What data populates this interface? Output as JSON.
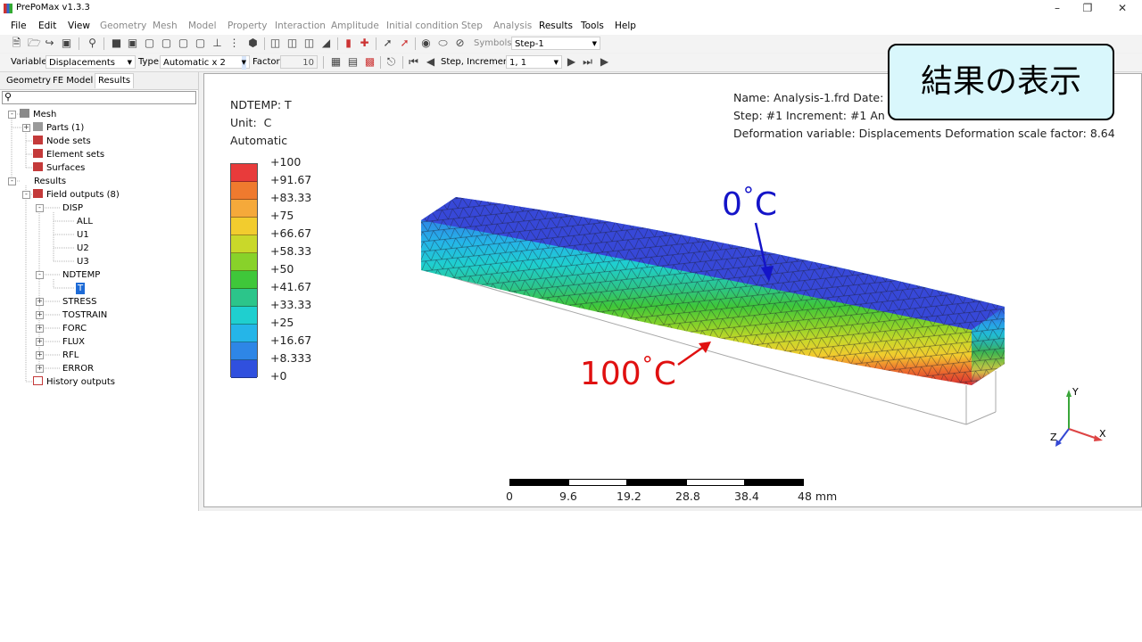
{
  "window": {
    "title": "PrePoMax v1.3.3"
  },
  "menu": [
    "File",
    "Edit",
    "View",
    "Geometry",
    "Mesh",
    "Model",
    "Property",
    "Interaction",
    "Amplitude",
    "Initial condition",
    "Step",
    "Analysis",
    "Results",
    "Tools",
    "Help"
  ],
  "toolbar": {
    "symbols_label": "Symbols",
    "symbols_value": "Step-1",
    "variable_label": "Variable",
    "variable_value": "Displacements",
    "type_label": "Type",
    "type_value": "Automatic x 2",
    "factor_label": "Factor",
    "factor_value": "10",
    "step_increment_label": "Step, Increment",
    "step_increment_value": "1, 1"
  },
  "left_panel": {
    "tabs": [
      "Geometry",
      "FE Model",
      "Results"
    ],
    "active_tab": "Results",
    "search_value": "",
    "tree": {
      "mesh": "Mesh",
      "parts": "Parts (1)",
      "node_sets": "Node sets",
      "element_sets": "Element sets",
      "surfaces": "Surfaces",
      "results": "Results",
      "field_outputs": "Field outputs (8)",
      "disp": "DISP",
      "disp_children": [
        "ALL",
        "U1",
        "U2",
        "U3"
      ],
      "ndtemp": "NDTEMP",
      "ndtemp_child": "T",
      "others": [
        "STRESS",
        "TOSTRAIN",
        "FORC",
        "FLUX",
        "RFL",
        "ERROR"
      ],
      "history_outputs": "History outputs"
    }
  },
  "viewport": {
    "legend": {
      "variable": "NDTEMP: T",
      "unit": "Unit:  C",
      "mode": "Automatic",
      "values": [
        "+100",
        "+91.67",
        "+83.33",
        "+75",
        "+66.67",
        "+58.33",
        "+50",
        "+41.67",
        "+33.33",
        "+25",
        "+16.67",
        "+8.333",
        "+0"
      ],
      "colors": [
        "#e83b3b",
        "#ef7a2e",
        "#f5a93a",
        "#f2cc2e",
        "#c9d82a",
        "#88d22a",
        "#3fc73a",
        "#2cc58a",
        "#1fcfcf",
        "#25b5e8",
        "#2e86e6",
        "#3050de"
      ]
    },
    "info": {
      "line1": "Name: Analysis-1.frd   Date:",
      "line2": "Step: #1   Increment: #1   An",
      "line3": "Deformation variable: Displacements   Deformation scale factor: 8.64"
    },
    "scale_labels": [
      "0",
      "9.6",
      "19.2",
      "28.8",
      "38.4",
      "48 mm"
    ],
    "axes": {
      "y": "Y",
      "x": "X",
      "z": "Z"
    }
  },
  "annotations": {
    "callout": "結果の表示",
    "top_value": "0",
    "bottom_value": "100",
    "deg_symbol": "°",
    "unit_letter": "C"
  }
}
